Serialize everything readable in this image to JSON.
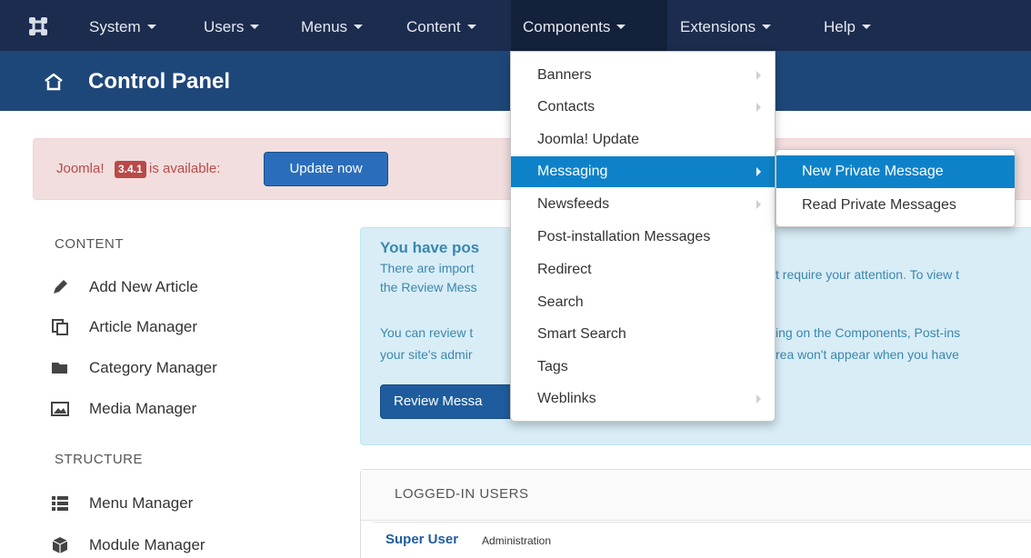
{
  "navbar": {
    "items": [
      {
        "label": "System"
      },
      {
        "label": "Users"
      },
      {
        "label": "Menus"
      },
      {
        "label": "Content"
      },
      {
        "label": "Components"
      },
      {
        "label": "Extensions"
      },
      {
        "label": "Help"
      }
    ]
  },
  "header": {
    "title": "Control Panel"
  },
  "alert": {
    "prefix": "Joomla!",
    "version": "3.4.1",
    "suffix": "is available:",
    "button": "Update now"
  },
  "sidebar": {
    "content_heading": "CONTENT",
    "content_items": [
      {
        "label": "Add New Article",
        "icon": "pencil-icon"
      },
      {
        "label": "Article Manager",
        "icon": "copy-icon"
      },
      {
        "label": "Category Manager",
        "icon": "folder-icon"
      },
      {
        "label": "Media Manager",
        "icon": "image-icon"
      }
    ],
    "structure_heading": "STRUCTURE",
    "structure_items": [
      {
        "label": "Menu Manager",
        "icon": "list-icon"
      },
      {
        "label": "Module Manager",
        "icon": "cube-icon"
      }
    ]
  },
  "info": {
    "title": "You have pos",
    "line1_left": "There are import",
    "line1_right": "t require your attention. To view t",
    "line2_left": "the Review Mess",
    "line3_left": "You can review t",
    "line3_right": "ing on the Components, Post-ins",
    "line4_left": "your site's admir",
    "line4_right": "rea won't appear when you have",
    "button": "Review Messa"
  },
  "logged_in": {
    "heading": "LOGGED-IN USERS",
    "user_name": "Super User",
    "user_role": "Administration"
  },
  "components_menu": {
    "items": [
      {
        "label": "Banners",
        "submenu": true
      },
      {
        "label": "Contacts",
        "submenu": true
      },
      {
        "label": "Joomla! Update",
        "submenu": false
      },
      {
        "label": "Messaging",
        "submenu": true,
        "active": true
      },
      {
        "label": "Newsfeeds",
        "submenu": true
      },
      {
        "label": "Post-installation Messages",
        "submenu": false
      },
      {
        "label": "Redirect",
        "submenu": false
      },
      {
        "label": "Search",
        "submenu": false
      },
      {
        "label": "Smart Search",
        "submenu": false
      },
      {
        "label": "Tags",
        "submenu": false
      },
      {
        "label": "Weblinks",
        "submenu": true
      }
    ]
  },
  "messaging_submenu": {
    "items": [
      {
        "label": "New Private Message",
        "active": true
      },
      {
        "label": "Read Private Messages"
      }
    ]
  },
  "colors": {
    "navbar": "#1b2c4e",
    "header": "#1e4779",
    "accent": "#0e82c9",
    "alert_bg": "#f2dede",
    "info_bg": "#d9edf7"
  }
}
